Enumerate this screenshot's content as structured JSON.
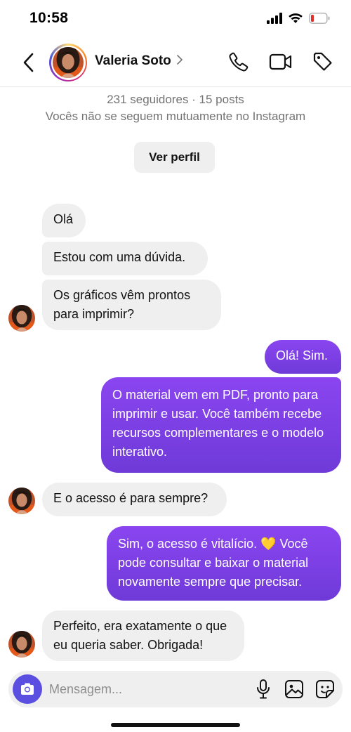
{
  "status_bar": {
    "time": "10:58"
  },
  "header": {
    "contact_name": "Valeria Soto",
    "name_chevron": "›",
    "icons": [
      "back-icon",
      "phone-icon",
      "video-icon",
      "tag-icon"
    ]
  },
  "profile": {
    "stats": "231 seguidores · 15 posts",
    "mutual_notice": "Vocês não se seguem mutuamente no Instagram",
    "view_profile_label": "Ver perfil"
  },
  "messages": [
    {
      "direction": "incoming",
      "text": "Olá"
    },
    {
      "direction": "incoming",
      "text": "Estou com uma dúvida."
    },
    {
      "direction": "incoming",
      "text": "Os gráficos vêm prontos para imprimir?"
    },
    {
      "direction": "outgoing",
      "text": "Olá! Sim."
    },
    {
      "direction": "outgoing",
      "text": "O material vem em PDF, pronto para imprimir e usar. Você também recebe recursos complementares e o modelo interativo."
    },
    {
      "direction": "incoming",
      "text": "E o acesso é para sempre?"
    },
    {
      "direction": "outgoing",
      "text": "Sim, o acesso é vitalício. 💛 Você pode consultar e baixar o material novamente sempre que precisar."
    },
    {
      "direction": "incoming",
      "text": "Perfeito, era exatamente o que eu queria saber. Obrigada!"
    }
  ],
  "composer": {
    "placeholder": "Mensagem...",
    "value": "",
    "icons": [
      "camera-icon",
      "microphone-icon",
      "gallery-icon",
      "sticker-icon"
    ]
  },
  "colors": {
    "outgoing_bubble": "#7b3fe4",
    "incoming_bubble": "#efefef",
    "camera_button": "#5a4fe0",
    "secondary_text": "#737373"
  }
}
